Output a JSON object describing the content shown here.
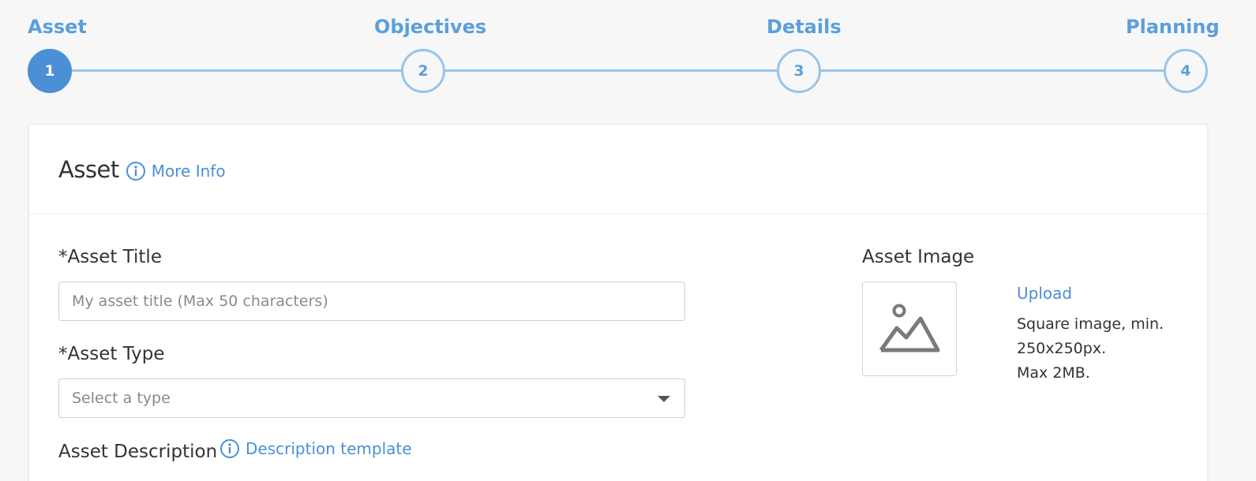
{
  "stepper": {
    "steps": [
      {
        "label": "Asset",
        "number": "1",
        "active": true
      },
      {
        "label": "Objectives",
        "number": "2",
        "active": false
      },
      {
        "label": "Details",
        "number": "3",
        "active": false
      },
      {
        "label": "Planning",
        "number": "4",
        "active": false
      }
    ]
  },
  "card": {
    "title": "Asset",
    "more_info_label": "More Info"
  },
  "form": {
    "asset_title": {
      "label": "*Asset Title",
      "placeholder": "My asset title (Max 50 characters)",
      "value": ""
    },
    "asset_type": {
      "label": "*Asset Type",
      "selected": "Select a type"
    },
    "asset_description": {
      "label": "Asset Description",
      "template_link": "Description template"
    },
    "asset_image": {
      "label": "Asset Image",
      "upload_label": "Upload",
      "help_lines": [
        "Square image, min.",
        "250x250px.",
        "Max 2MB."
      ]
    }
  },
  "icons": {
    "info": "info-circle-icon",
    "image_placeholder": "image-placeholder-icon",
    "dropdown": "chevron-down-icon"
  },
  "colors": {
    "accent": "#4b8fd6",
    "step_inactive": "#9bc3e8",
    "background": "#f7f7f7"
  }
}
